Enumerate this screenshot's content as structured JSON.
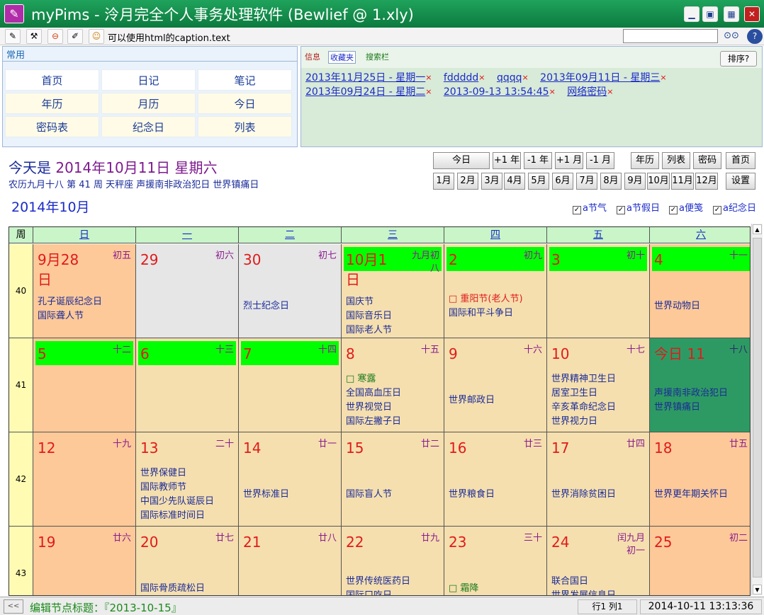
{
  "window": {
    "title": "myPims - 泠月完全个人事务处理软件 (Bewlief @ 1.xly)"
  },
  "toolbar": {
    "caption": "可以使用html的caption.text",
    "search_value": ""
  },
  "common": {
    "label": "常用",
    "buttons": [
      "首页",
      "日记",
      "笔记",
      "年历",
      "月历",
      "今日",
      "密码表",
      "纪念日",
      "列表"
    ]
  },
  "tags": {
    "tabs": [
      "信息",
      "收藏夹",
      "搜索栏"
    ],
    "sort_label": "排序?",
    "items": [
      "2013年11月25日 - 星期一",
      "fddddd",
      "qqqq",
      "2013年09月11日 - 星期三",
      "2013年09月24日 - 星期二",
      "2013-09-13 13:54:45",
      "网络密码"
    ],
    "close_mark": "×"
  },
  "header": {
    "today_prefix": "今天是",
    "today_date": "2014年10月11日 星期六",
    "lunar_info": "农历九月十八 第 41 周 天秤座 声援南非政治犯日 世界镇痛日",
    "month_title": "2014年10月"
  },
  "nav": {
    "row1": [
      "今日",
      "+1 年",
      "-1 年",
      "+1 月",
      "-1 月",
      "年历",
      "列表",
      "密码",
      "首页"
    ],
    "row2": [
      "1月",
      "2月",
      "3月",
      "4月",
      "5月",
      "6月",
      "7月",
      "8月",
      "9月",
      "10月",
      "11月",
      "12月",
      "设置"
    ]
  },
  "options": [
    "a节气",
    "a节假日",
    "a便笺",
    "a纪念日"
  ],
  "calendar": {
    "headers": [
      "周",
      "日",
      "一",
      "二",
      "三",
      "四",
      "五",
      "六"
    ],
    "weeks": [
      {
        "num": "40",
        "days": [
          {
            "day": "9月28日",
            "lunar": "初五",
            "bg": "#fdc998",
            "events": [
              {
                "t": "孔子诞辰纪念日"
              },
              {
                "t": "国际聋人节"
              }
            ]
          },
          {
            "day": "29",
            "lunar": "初六",
            "bg": "#e6e6e6",
            "events": []
          },
          {
            "day": "30",
            "lunar": "初七",
            "bg": "#e6e6e6",
            "events": [
              {
                "t": "烈士纪念日"
              }
            ]
          },
          {
            "day": "10月1日",
            "lunar": "九月初八",
            "bg": "#f5dfae",
            "bar": true,
            "events": [
              {
                "t": "国庆节"
              },
              {
                "t": "国际音乐日"
              },
              {
                "t": "国际老人节"
              }
            ]
          },
          {
            "day": "2",
            "lunar": "初九",
            "bg": "#f5dfae",
            "bar": true,
            "events": [
              {
                "t": "□ 重阳节(老人节)",
                "c": "red"
              },
              {
                "t": "国际和平斗争日"
              }
            ]
          },
          {
            "day": "3",
            "lunar": "初十",
            "bg": "#f5dfae",
            "bar": true,
            "events": []
          },
          {
            "day": "4",
            "lunar": "十一",
            "bg": "#fdc998",
            "bar": true,
            "events": [
              {
                "t": "世界动物日"
              }
            ]
          }
        ]
      },
      {
        "num": "41",
        "days": [
          {
            "day": "5",
            "lunar": "十二",
            "bg": "#fdc998",
            "bar": true,
            "events": []
          },
          {
            "day": "6",
            "lunar": "十三",
            "bg": "#f5dfae",
            "bar": true,
            "events": []
          },
          {
            "day": "7",
            "lunar": "十四",
            "bg": "#f5dfae",
            "bar": true,
            "events": []
          },
          {
            "day": "8",
            "lunar": "十五",
            "bg": "#f5dfae",
            "events": [
              {
                "t": "□ 寒露",
                "c": "grn"
              },
              {
                "t": "全国高血压日"
              },
              {
                "t": "世界视觉日"
              },
              {
                "t": "国际左撇子日"
              }
            ]
          },
          {
            "day": "9",
            "lunar": "十六",
            "bg": "#f5dfae",
            "events": [
              {
                "t": "世界邮政日"
              }
            ]
          },
          {
            "day": "10",
            "lunar": "十七",
            "bg": "#f5dfae",
            "events": [
              {
                "t": "世界精神卫生日"
              },
              {
                "t": "居室卫生日"
              },
              {
                "t": "辛亥革命纪念日"
              },
              {
                "t": "世界视力日"
              }
            ]
          },
          {
            "day": "今日 11",
            "lunar": "十八",
            "bg": "#2e9a63",
            "events": [
              {
                "t": "声援南非政治犯日"
              },
              {
                "t": "世界镇痛日"
              }
            ]
          }
        ]
      },
      {
        "num": "42",
        "days": [
          {
            "day": "12",
            "lunar": "十九",
            "bg": "#fdc998",
            "events": []
          },
          {
            "day": "13",
            "lunar": "二十",
            "bg": "#f5dfae",
            "events": [
              {
                "t": "世界保健日"
              },
              {
                "t": "国际教师节"
              },
              {
                "t": "中国少先队诞辰日"
              },
              {
                "t": "国际标准时间日"
              }
            ]
          },
          {
            "day": "14",
            "lunar": "廿一",
            "bg": "#f5dfae",
            "events": [
              {
                "t": "世界标准日"
              }
            ]
          },
          {
            "day": "15",
            "lunar": "廿二",
            "bg": "#f5dfae",
            "events": [
              {
                "t": "国际盲人节"
              }
            ]
          },
          {
            "day": "16",
            "lunar": "廿三",
            "bg": "#f5dfae",
            "events": [
              {
                "t": "世界粮食日"
              }
            ]
          },
          {
            "day": "17",
            "lunar": "廿四",
            "bg": "#f5dfae",
            "events": [
              {
                "t": "世界消除贫困日"
              }
            ]
          },
          {
            "day": "18",
            "lunar": "廿五",
            "bg": "#fdc998",
            "events": [
              {
                "t": "世界更年期关怀日"
              }
            ]
          }
        ]
      },
      {
        "num": "43",
        "days": [
          {
            "day": "19",
            "lunar": "廿六",
            "bg": "#fdc998",
            "events": []
          },
          {
            "day": "20",
            "lunar": "廿七",
            "bg": "#f5dfae",
            "events": [
              {
                "t": "国际骨质疏松日"
              }
            ]
          },
          {
            "day": "21",
            "lunar": "廿八",
            "bg": "#f5dfae",
            "events": []
          },
          {
            "day": "22",
            "lunar": "廿九",
            "bg": "#f5dfae",
            "events": [
              {
                "t": "世界传统医药日"
              },
              {
                "t": "国际口吃日"
              }
            ]
          },
          {
            "day": "23",
            "lunar": "三十",
            "bg": "#f5dfae",
            "events": [
              {
                "t": "□ 霜降",
                "c": "grn"
              }
            ]
          },
          {
            "day": "24",
            "lunar": "闰九月初一",
            "bg": "#f5dfae",
            "events": [
              {
                "t": "联合国日"
              },
              {
                "t": "世界发展信息日"
              }
            ]
          },
          {
            "day": "25",
            "lunar": "初二",
            "bg": "#fdc998",
            "events": []
          }
        ]
      }
    ]
  },
  "status": {
    "left_label": "<<",
    "text": "编辑节点标题：『2013-10-15』",
    "position": "行1 列1",
    "datetime": "2014-10-11 13:13:36"
  }
}
